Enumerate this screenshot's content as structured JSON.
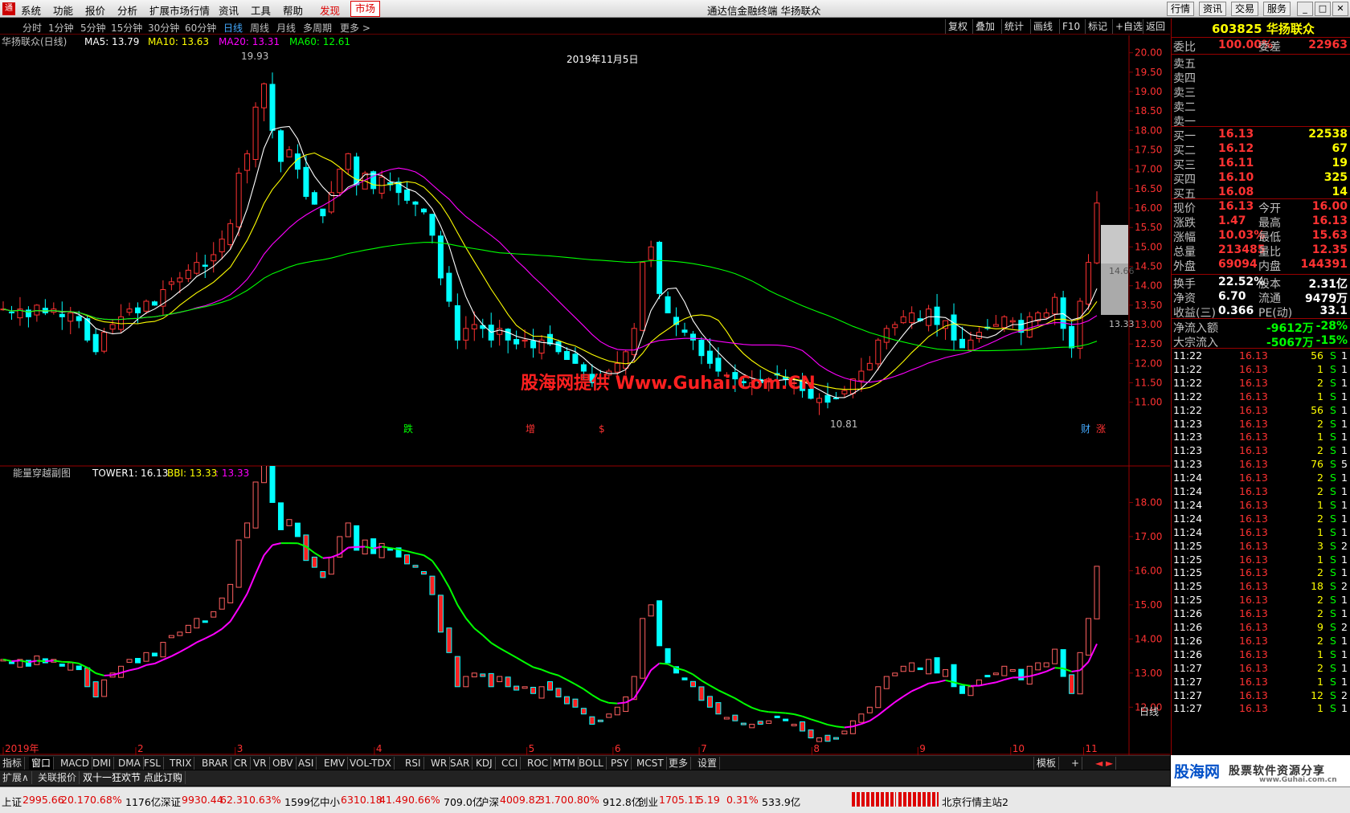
{
  "titlebar": {
    "menus": [
      "系统",
      "功能",
      "报价",
      "分析",
      "扩展市场行情",
      "资讯",
      "工具",
      "帮助"
    ],
    "discover": "发现",
    "market": "市场",
    "window_title": "通达信金融终端 华扬联众",
    "right_buttons": [
      "行情",
      "资讯",
      "交易",
      "服务"
    ],
    "win_ctrl": [
      "_",
      "□",
      "✕"
    ]
  },
  "periodbar": {
    "items": [
      "分时",
      "1分钟",
      "5分钟",
      "15分钟",
      "30分钟",
      "60分钟",
      "日线",
      "周线",
      "月线",
      "多周期",
      "更多 >"
    ],
    "active": "日线",
    "tools": [
      "复权",
      "叠加",
      "统计",
      "画线",
      "F10",
      "标记",
      "+自选",
      "返回"
    ]
  },
  "main_legend": {
    "name": "华扬联众(日线)",
    "ma5": "MA5: 13.79",
    "ma10": "MA10: 13.63",
    "ma20": "MA20: 13.31",
    "ma60": "MA60: 12.61"
  },
  "main_annotations": {
    "date_label": "2019年11月5日",
    "high": "19.93",
    "low": "10.81",
    "watermark": "股海网提供 Www.Guhai.Com.CN",
    "level1": "14.66",
    "level2": "13.33"
  },
  "event_markers": [
    "跌",
    "增",
    "$",
    "财",
    "涨"
  ],
  "sub_legend": {
    "name": "能量穿越副图",
    "tower": "TOWER1: 16.13",
    "bbi": "BBI: 13.33",
    "bbi2": ": 13.33"
  },
  "chart_data": [
    {
      "type": "candlestick",
      "panel": "main",
      "title": "华扬联众(日线)",
      "yticks": [
        "20.00",
        "19.50",
        "19.00",
        "18.50",
        "18.00",
        "17.50",
        "17.00",
        "16.50",
        "16.00",
        "15.50",
        "15.00",
        "14.50",
        "14.00",
        "13.50",
        "13.00",
        "12.50",
        "12.00",
        "11.50",
        "11.00"
      ],
      "ylim": [
        10.6,
        20.2
      ],
      "xticks": [
        "2019年",
        "2",
        "3",
        "4",
        "5",
        "6",
        "7",
        "8",
        "9",
        "10",
        "11"
      ],
      "series": [
        "MA5",
        "MA10",
        "MA20",
        "MA60"
      ],
      "close": [
        13.4,
        13.3,
        13.4,
        13.2,
        13.5,
        13.3,
        13.4,
        13.2,
        13.3,
        13.1,
        12.6,
        12.3,
        12.8,
        13.0,
        13.2,
        13.4,
        13.3,
        13.6,
        13.5,
        13.9,
        14.1,
        14.2,
        14.4,
        14.6,
        14.5,
        14.8,
        15.2,
        15.6,
        16.9,
        17.4,
        18.6,
        19.2,
        18.0,
        17.2,
        17.5,
        17.0,
        16.3,
        16.1,
        15.8,
        16.4,
        17.0,
        17.4,
        16.6,
        16.9,
        16.5,
        16.8,
        16.6,
        16.4,
        16.2,
        16.1,
        15.9,
        15.3,
        14.2,
        13.6,
        12.6,
        12.9,
        13.0,
        12.9,
        12.6,
        12.9,
        12.6,
        12.5,
        12.6,
        12.4,
        12.6,
        12.5,
        12.3,
        12.1,
        12.0,
        11.8,
        11.5,
        11.6,
        11.8,
        12.0,
        12.3,
        12.9,
        14.6,
        15.0,
        13.8,
        13.3,
        13.0,
        12.8,
        12.6,
        12.2,
        12.0,
        11.8,
        11.7,
        11.6,
        11.5,
        11.5,
        11.5,
        11.6,
        11.7,
        11.6,
        11.5,
        11.3,
        11.1,
        11.1,
        11.0,
        11.1,
        11.3,
        11.6,
        11.8,
        12.0,
        12.6,
        12.9,
        13.0,
        13.2,
        13.3,
        13.1,
        13.4,
        13.0,
        13.1,
        12.6,
        12.4,
        12.6,
        12.8,
        12.9,
        13.0,
        13.2,
        13.1,
        12.8,
        13.2,
        13.3,
        13.3,
        13.7,
        12.9,
        12.4,
        13.6,
        14.6,
        16.13
      ],
      "ma_last": {
        "MA5": 13.79,
        "MA10": 13.63,
        "MA20": 13.31,
        "MA60": 12.61
      }
    },
    {
      "type": "indicator",
      "panel": "sub",
      "title": "能量穿越副图",
      "series": [
        "TOWER1",
        "BBI"
      ],
      "yticks": [
        "18.00",
        "17.00",
        "16.00",
        "15.00",
        "14.00",
        "13.00",
        "12.00"
      ],
      "ylim": [
        11.3,
        18.6
      ],
      "values": {
        "TOWER1": 16.13,
        "BBI": 13.33
      }
    }
  ],
  "quote": {
    "code_name": "603825 华扬联众",
    "webi_label": "委比",
    "webi": "100.00%",
    "weicha_label": "委差",
    "weicha": "22963",
    "sells": [
      {
        "label": "卖五",
        "price": "",
        "vol": ""
      },
      {
        "label": "卖四",
        "price": "",
        "vol": ""
      },
      {
        "label": "卖三",
        "price": "",
        "vol": ""
      },
      {
        "label": "卖二",
        "price": "",
        "vol": ""
      },
      {
        "label": "卖一",
        "price": "",
        "vol": ""
      }
    ],
    "buys": [
      {
        "label": "买一",
        "price": "16.13",
        "vol": "22538"
      },
      {
        "label": "买二",
        "price": "16.12",
        "vol": "67"
      },
      {
        "label": "买三",
        "price": "16.11",
        "vol": "19"
      },
      {
        "label": "买四",
        "price": "16.10",
        "vol": "325"
      },
      {
        "label": "买五",
        "price": "16.08",
        "vol": "14"
      }
    ],
    "stats": [
      {
        "l1": "现价",
        "v1": "16.13",
        "l2": "今开",
        "v2": "16.00"
      },
      {
        "l1": "涨跌",
        "v1": "1.47",
        "l2": "最高",
        "v2": "16.13"
      },
      {
        "l1": "涨幅",
        "v1": "10.03%",
        "l2": "最低",
        "v2": "15.63"
      },
      {
        "l1": "总量",
        "v1": "213485",
        "l2": "量比",
        "v2": "12.35"
      },
      {
        "l1": "外盘",
        "v1": "69094",
        "l2": "内盘",
        "v2": "144391"
      }
    ],
    "stats2": [
      {
        "l1": "换手",
        "v1": "22.52%",
        "l2": "股本",
        "v2": "2.31亿"
      },
      {
        "l1": "净资",
        "v1": "6.70",
        "l2": "流通",
        "v2": "9479万"
      },
      {
        "l1": "收益(三)",
        "v1": "0.366",
        "l2": "PE(动)",
        "v2": "33.1"
      }
    ],
    "flows": [
      {
        "label": "净流入额",
        "value": "-9612万",
        "pct": "-28%"
      },
      {
        "label": "大宗流入",
        "value": "-5067万",
        "pct": "-15%"
      }
    ],
    "ticks": [
      [
        "11:22",
        "16.13",
        "56",
        "S",
        "1"
      ],
      [
        "11:22",
        "16.13",
        "1",
        "S",
        "1"
      ],
      [
        "11:22",
        "16.13",
        "2",
        "S",
        "1"
      ],
      [
        "11:22",
        "16.13",
        "1",
        "S",
        "1"
      ],
      [
        "11:22",
        "16.13",
        "56",
        "S",
        "1"
      ],
      [
        "11:23",
        "16.13",
        "2",
        "S",
        "1"
      ],
      [
        "11:23",
        "16.13",
        "1",
        "S",
        "1"
      ],
      [
        "11:23",
        "16.13",
        "2",
        "S",
        "1"
      ],
      [
        "11:23",
        "16.13",
        "76",
        "S",
        "5"
      ],
      [
        "11:24",
        "16.13",
        "2",
        "S",
        "1"
      ],
      [
        "11:24",
        "16.13",
        "2",
        "S",
        "1"
      ],
      [
        "11:24",
        "16.13",
        "1",
        "S",
        "1"
      ],
      [
        "11:24",
        "16.13",
        "2",
        "S",
        "1"
      ],
      [
        "11:24",
        "16.13",
        "1",
        "S",
        "1"
      ],
      [
        "11:25",
        "16.13",
        "3",
        "S",
        "2"
      ],
      [
        "11:25",
        "16.13",
        "1",
        "S",
        "1"
      ],
      [
        "11:25",
        "16.13",
        "2",
        "S",
        "1"
      ],
      [
        "11:25",
        "16.13",
        "18",
        "S",
        "2"
      ],
      [
        "11:25",
        "16.13",
        "2",
        "S",
        "1"
      ],
      [
        "11:26",
        "16.13",
        "2",
        "S",
        "1"
      ],
      [
        "11:26",
        "16.13",
        "9",
        "S",
        "2"
      ],
      [
        "11:26",
        "16.13",
        "2",
        "S",
        "1"
      ],
      [
        "11:26",
        "16.13",
        "1",
        "S",
        "1"
      ],
      [
        "11:27",
        "16.13",
        "2",
        "S",
        "1"
      ],
      [
        "11:27",
        "16.13",
        "1",
        "S",
        "1"
      ],
      [
        "11:27",
        "16.13",
        "12",
        "S",
        "2"
      ],
      [
        "11:27",
        "16.13",
        "1",
        "S",
        "1"
      ]
    ]
  },
  "bottom_tabs": [
    "指标",
    "窗口",
    "MACD",
    "DMI",
    "DMA",
    "FSL",
    "TRIX",
    "BRAR",
    "CR",
    "VR",
    "OBV",
    "ASI",
    "EMV",
    "VOL-TDX",
    "RSI",
    "WR",
    "SAR",
    "KDJ",
    "CCI",
    "ROC",
    "MTM",
    "BOLL",
    "PSY",
    "MCST",
    "更多",
    "设置"
  ],
  "bottom_right": {
    "template": "模板",
    "plus": "+",
    "arrows": "◄ ►",
    "daily": "日线"
  },
  "bottom2": [
    "扩展∧",
    "关联报价",
    "双十一狂欢节 点此订购"
  ],
  "status": [
    {
      "name": "上证",
      "v": "2995.66",
      "c": "20.17",
      "p": "0.68%",
      "a": "1176亿"
    },
    {
      "name": "深证",
      "v": "9930.44",
      "c": "62.31",
      "p": "0.63%",
      "a": "1599亿"
    },
    {
      "name": "中小",
      "v": "6310.18",
      "c": "41.49",
      "p": "0.66%",
      "a": "709.0亿"
    },
    {
      "name": "沪深",
      "v": "4009.82",
      "c": "31.70",
      "p": "0.80%",
      "a": "912.8亿"
    },
    {
      "name": "创业",
      "v": "1705.11",
      "c": "5.19",
      "p": "0.31%",
      "a": "533.9亿"
    }
  ],
  "server": "北京行情主站2",
  "footer": {
    "brand": "股海网",
    "slogan": "股票软件资源分享",
    "url": "www.Guhai.com.cn"
  },
  "colors": {
    "up": "#ff3232",
    "down": "#00ffff",
    "ma5": "#ffffff",
    "ma10": "#ffff00",
    "ma20": "#ff00ff",
    "ma60": "#00ff00",
    "grid": "#800000"
  }
}
